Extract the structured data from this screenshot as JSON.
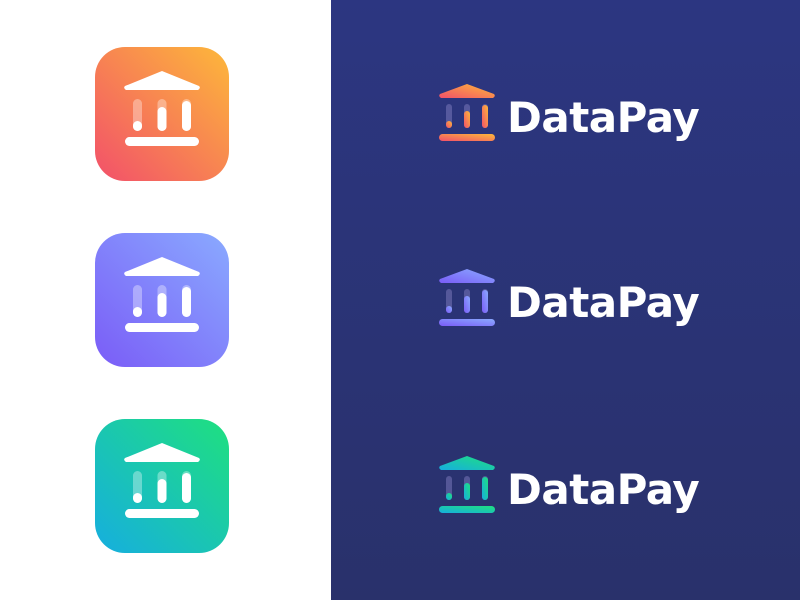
{
  "brand": {
    "name": "DataPay",
    "icon_semantic": "bank-building-bar-chart-icon"
  },
  "colors": {
    "background_left": "#ffffff",
    "background_right_top": "#2c3681",
    "background_right_bottom": "#29316b",
    "wordmark": "#ffffff"
  },
  "variants": [
    {
      "theme": "orange",
      "gradient_start": "#fdb83a",
      "gradient_end": "#f2506a",
      "wordmark": "DataPay"
    },
    {
      "theme": "purple",
      "gradient_start": "#8aaaff",
      "gradient_end": "#7a5cf7",
      "wordmark": "DataPay"
    },
    {
      "theme": "green",
      "gradient_start": "#1fe07f",
      "gradient_end": "#16aedf",
      "wordmark": "DataPay"
    }
  ]
}
